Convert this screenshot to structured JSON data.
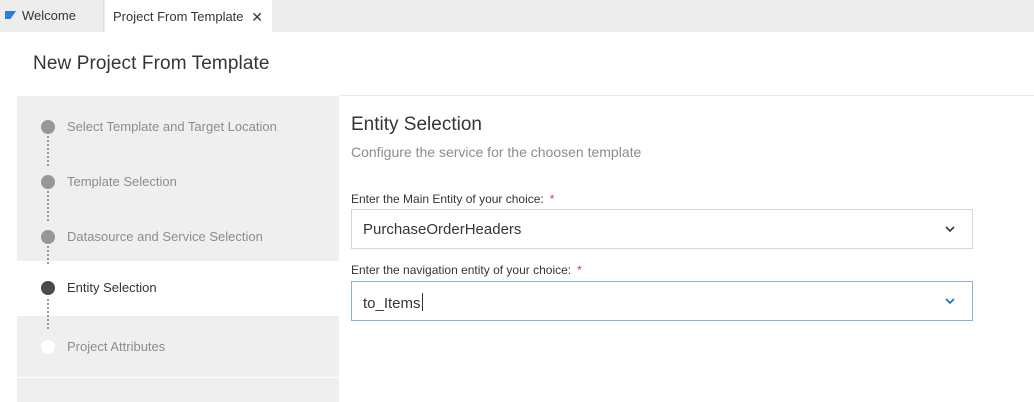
{
  "tabs": {
    "welcome": {
      "label": "Welcome",
      "icon": "sap-logo-icon"
    },
    "project": {
      "label": "Project From Template",
      "close_icon": "close-icon",
      "close_glyph": "✕"
    }
  },
  "page": {
    "title": "New Project From Template"
  },
  "wizard": {
    "steps": [
      {
        "label": "Select Template and Target Location",
        "state": "completed"
      },
      {
        "label": "Template Selection",
        "state": "completed"
      },
      {
        "label": "Datasource and Service Selection",
        "state": "completed"
      },
      {
        "label": "Entity Selection",
        "state": "active"
      },
      {
        "label": "Project Attributes",
        "state": "pending"
      }
    ]
  },
  "entity_selection": {
    "title": "Entity Selection",
    "subtitle": "Configure the service for the choosen template",
    "main_entity": {
      "label": "Enter the Main Entity of your choice:",
      "required_mark": "*",
      "value": "PurchaseOrderHeaders",
      "icon": "chevron-down-icon"
    },
    "navigation_entity": {
      "label": "Enter the navigation entity of your choice:",
      "required_mark": "*",
      "value": "to_Items",
      "icon": "chevron-down-icon"
    }
  },
  "colors": {
    "accent_focus": "#89b3d9",
    "required": "#e0402f",
    "chevron": "#0a6ed1",
    "step_active": "#4a4a4a",
    "step_completed": "#979797"
  }
}
